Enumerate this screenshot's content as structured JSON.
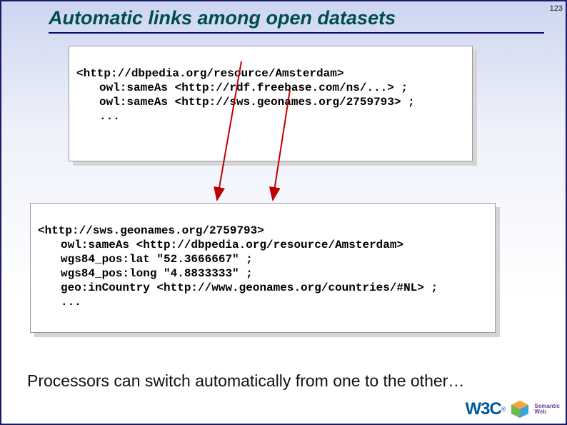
{
  "slide_number": "123",
  "title": "Automatic links among open datasets",
  "code1": {
    "l1": "<http://dbpedia.org/resource/Amsterdam>",
    "l2": "owl:sameAs <http://rdf.freebase.com/ns/...> ;",
    "l3": "owl:sameAs <http://sws.geonames.org/2759793> ;",
    "l4": "..."
  },
  "code2": {
    "l1": "<http://sws.geonames.org/2759793>",
    "l2": "owl:sameAs <http://dbpedia.org/resource/Amsterdam>",
    "l3": "wgs84_pos:lat \"52.3666667\" ;",
    "l4": "wgs84_pos:long \"4.8833333\" ;",
    "l5": "geo:inCountry <http://www.geonames.org/countries/#NL> ;",
    "l6": "..."
  },
  "caption": "Processors can switch automatically from one to the other…",
  "logos": {
    "w3c": "W3C",
    "sw1": "Semantic",
    "sw2": "Web"
  }
}
